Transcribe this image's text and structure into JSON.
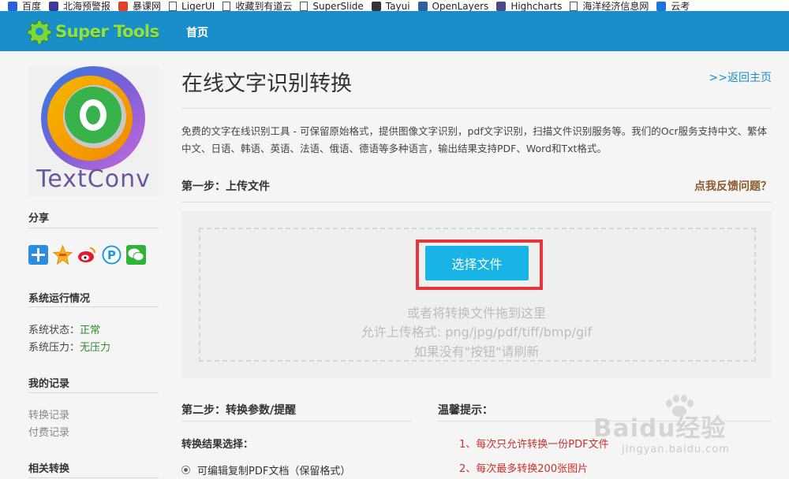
{
  "bookmarks": [
    {
      "label": "百度",
      "icon": "paw-icon",
      "color": "#2b5fd9"
    },
    {
      "label": "北海预警报",
      "icon": "shield-icon",
      "color": "#3a3a9a"
    },
    {
      "label": "暴课网",
      "icon": "flame-icon",
      "color": "#e0402a"
    },
    {
      "label": "LigerUI",
      "icon": "page-icon",
      "color": "#ffffff"
    },
    {
      "label": "收藏到有道云",
      "icon": "page-icon",
      "color": "#ffffff"
    },
    {
      "label": "SuperSlide",
      "icon": "page-icon",
      "color": "#ffffff"
    },
    {
      "label": "Tayui",
      "icon": "app-icon",
      "color": "#333333"
    },
    {
      "label": "OpenLayers",
      "icon": "layers-icon",
      "color": "#2f5f9e"
    },
    {
      "label": "Highcharts",
      "icon": "chart-icon",
      "color": "#4a4a8a"
    },
    {
      "label": "海洋经济信息网",
      "icon": "page-icon",
      "color": "#ffffff"
    },
    {
      "label": "云考",
      "icon": "e-icon",
      "color": "#1e73d8"
    }
  ],
  "header": {
    "logo_text": "Super Tools",
    "nav_home": "首页",
    "bg_color": "#1a8ec9"
  },
  "sidebar": {
    "app_logo_text": "TextConv",
    "share_title": "分享",
    "share_icons": [
      "plus-icon",
      "star-icon",
      "weibo-icon",
      "p-icon",
      "wechat-icon"
    ],
    "status_title": "系统运行情况",
    "status_label": "系统状态：",
    "status_value": "正常",
    "load_label": "系统压力：",
    "load_value": "无压力",
    "records_title": "我的记录",
    "record_links": [
      "转换记录",
      "付费记录"
    ],
    "related_title": "相关转换"
  },
  "main": {
    "title": "在线文字识别转换",
    "back_link": ">>返回主页",
    "intro": "免费的文字在线识别工具 - 可保留原始格式，提供图像文字识别，pdf文字识别，扫描文件识别服务等。我们的Ocr服务支持中文、繁体中文、日语、韩语、英语、法语、俄语、德语等多种语言，输出结果支持PDF、Word和Txt格式。",
    "step1_title": "第一步：上传文件",
    "feedback": "点我反馈问题？",
    "choose_button": "选择文件",
    "hints": [
      "或者将转换文件拖到这里",
      "允许上传格式: png/jpg/pdf/tiff/bmp/gif",
      "如果没有\"按钮\"请刷新"
    ],
    "step2_title": "第二步：转换参数/提醒",
    "result_label": "转换结果选择：",
    "option1": "可编辑复制PDF文档（保留格式）",
    "tips_title": "温馨提示：",
    "tips": [
      "1、每次只允许转换一份PDF文件",
      "2、每次最多转换200张图片"
    ]
  },
  "watermark": {
    "main": "Baidu经验",
    "sub": "jingyan.baidu.com"
  }
}
